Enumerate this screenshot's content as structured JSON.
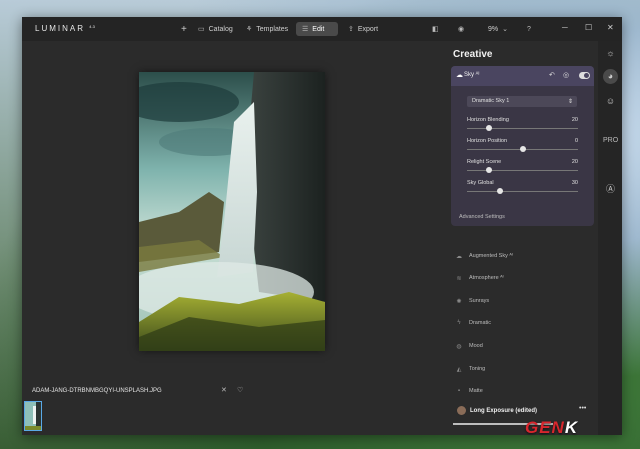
{
  "app": {
    "logo": "LUMINAR",
    "logo_sup": "4.3"
  },
  "titlebar": {
    "add": "+",
    "catalog": "Catalog",
    "templates": "Templates",
    "edit": "Edit",
    "export": "Export",
    "zoom": "9%",
    "zoom_chevron": "⌄"
  },
  "canvas": {
    "filename": "ADAM-JANG-DTRBNMBGQYI-UNSPLASH.JPG"
  },
  "panel": {
    "title": "Creative",
    "sky": {
      "title": "Sky ᴬᴵ",
      "select_value": "Dramatic Sky 1",
      "sliders": [
        {
          "label": "Horizon Blending",
          "value": "20",
          "level": 0.2
        },
        {
          "label": "Horizon Position",
          "value": "0",
          "level": 0.5
        },
        {
          "label": "Relight Scene",
          "value": "20",
          "level": 0.2
        },
        {
          "label": "Sky Global",
          "value": "30",
          "level": 0.3
        }
      ],
      "advanced": "Advanced Settings"
    },
    "tools": [
      {
        "label": "Augmented Sky ᴬᴵ",
        "icon": "cloud-icon"
      },
      {
        "label": "Atmosphere ᴬᴵ",
        "icon": "fog-icon"
      },
      {
        "label": "Sunrays",
        "icon": "sun-icon"
      },
      {
        "label": "Dramatic",
        "icon": "lightning-icon"
      },
      {
        "label": "Mood",
        "icon": "mood-icon"
      },
      {
        "label": "Toning",
        "icon": "toning-icon"
      },
      {
        "label": "Matte",
        "icon": "matte-icon"
      }
    ],
    "preset": {
      "name": "Long Exposure (edited)",
      "more": "•••"
    }
  },
  "rail": {
    "pro": "PRO"
  },
  "watermark": {
    "prefix": "GEN",
    "suffix": "K"
  },
  "colors": {
    "accent": "#5aa9e6",
    "sky_card": "#3a3645",
    "sky_header": "#4a4560",
    "bg": "#2b2b2b"
  }
}
